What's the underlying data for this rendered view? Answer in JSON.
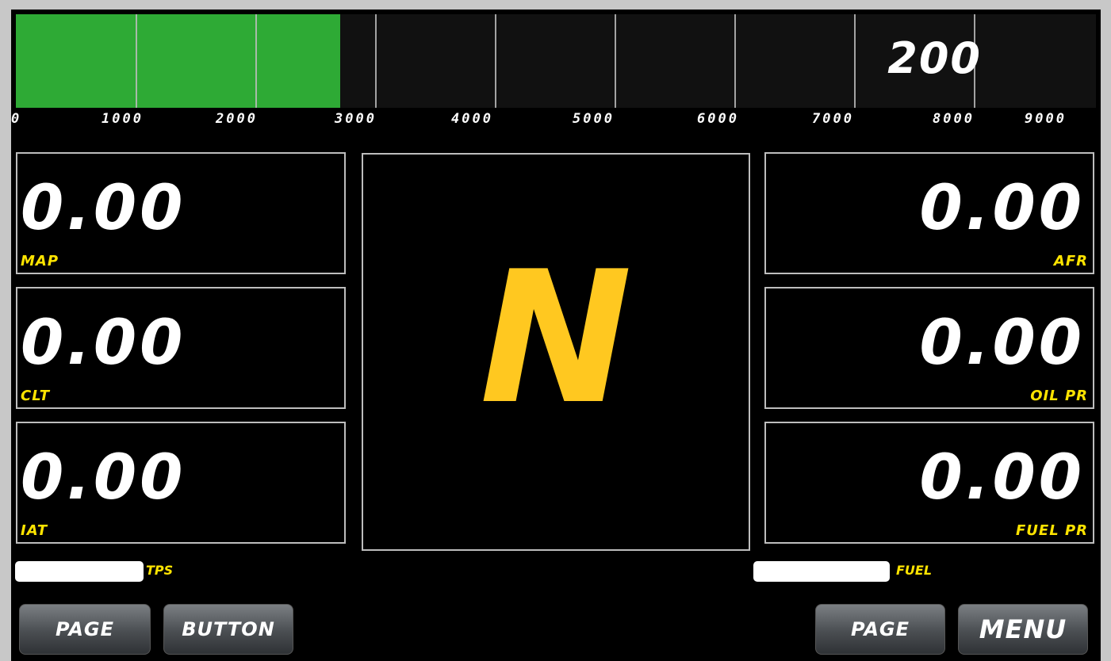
{
  "rpm": {
    "value": 2700,
    "max": 9000,
    "fill_color": "#2eaa35",
    "ticks": [
      "0",
      "1000",
      "2000",
      "3000",
      "4000",
      "5000",
      "6000",
      "7000",
      "8000",
      "9000"
    ]
  },
  "speed": "200",
  "gauges": {
    "left": [
      {
        "value": "0.00",
        "label": "MAP"
      },
      {
        "value": "0.00",
        "label": "CLT"
      },
      {
        "value": "0.00",
        "label": "IAT"
      }
    ],
    "right": [
      {
        "value": "0.00",
        "label": "AFR"
      },
      {
        "value": "0.00",
        "label": "OIL PR"
      },
      {
        "value": "0.00",
        "label": "FUEL PR"
      }
    ]
  },
  "gear": "N",
  "gear_color": "#ffc820",
  "label_color": "#ffe400",
  "bars": {
    "tps": {
      "label": "TPS"
    },
    "fuel": {
      "label": "FUEL"
    }
  },
  "buttons": {
    "page_left": "PAGE",
    "button": "BUTTON",
    "page_right": "PAGE",
    "menu": "MENU"
  }
}
